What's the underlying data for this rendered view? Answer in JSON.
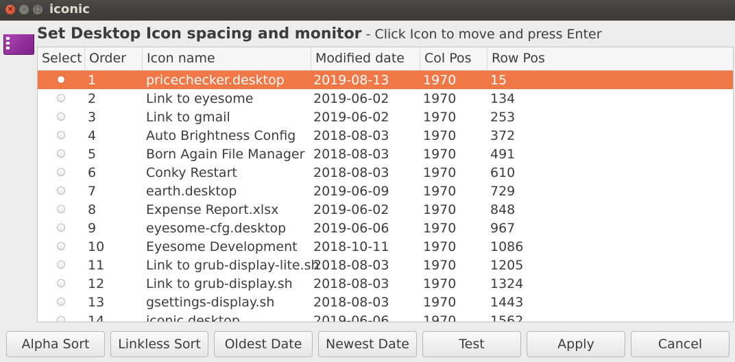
{
  "window": {
    "title": "iconic"
  },
  "heading": {
    "main": "Set Desktop Icon spacing and monitor",
    "sub": " - Click Icon to move and press Enter"
  },
  "table": {
    "columns": [
      "Select",
      "Order",
      "Icon name",
      "Modified date",
      "Col Pos",
      "Row Pos"
    ],
    "selected_index": 0,
    "rows": [
      {
        "order": "1",
        "name": "pricechecker.desktop",
        "date": "2019-08-13",
        "col": "1970",
        "row": "15"
      },
      {
        "order": "2",
        "name": "Link to eyesome",
        "date": "2019-06-02",
        "col": "1970",
        "row": "134"
      },
      {
        "order": "3",
        "name": "Link to gmail",
        "date": "2019-06-02",
        "col": "1970",
        "row": "253"
      },
      {
        "order": "4",
        "name": "Auto Brightness Config",
        "date": "2018-08-03",
        "col": "1970",
        "row": "372"
      },
      {
        "order": "5",
        "name": "Born Again File Manager",
        "date": "2018-08-03",
        "col": "1970",
        "row": "491"
      },
      {
        "order": "6",
        "name": "Conky Restart",
        "date": "2018-08-03",
        "col": "1970",
        "row": "610"
      },
      {
        "order": "7",
        "name": "earth.desktop",
        "date": "2019-06-09",
        "col": "1970",
        "row": "729"
      },
      {
        "order": "8",
        "name": "Expense Report.xlsx",
        "date": "2019-06-02",
        "col": "1970",
        "row": "848"
      },
      {
        "order": "9",
        "name": "eyesome-cfg.desktop",
        "date": "2019-06-06",
        "col": "1970",
        "row": "967"
      },
      {
        "order": "10",
        "name": "Eyesome Development",
        "date": "2018-10-11",
        "col": "1970",
        "row": "1086"
      },
      {
        "order": "11",
        "name": "Link to grub-display-lite.sh",
        "date": "2018-08-03",
        "col": "1970",
        "row": "1205"
      },
      {
        "order": "12",
        "name": "Link to grub-display.sh",
        "date": "2018-08-03",
        "col": "1970",
        "row": "1324"
      },
      {
        "order": "13",
        "name": "gsettings-display.sh",
        "date": "2018-08-03",
        "col": "1970",
        "row": "1443"
      },
      {
        "order": "14",
        "name": "iconic.desktop",
        "date": "2019-06-06",
        "col": "1970",
        "row": "1562"
      }
    ]
  },
  "buttons": {
    "alpha_sort": "Alpha Sort",
    "linkless_sort": "Linkless Sort",
    "oldest_date": "Oldest Date",
    "newest_date": "Newest Date",
    "test": "Test",
    "apply": "Apply",
    "cancel": "Cancel"
  },
  "colors": {
    "selection": "#f07746",
    "titlebar": "#3c3b37",
    "close_button": "#e0552e"
  }
}
